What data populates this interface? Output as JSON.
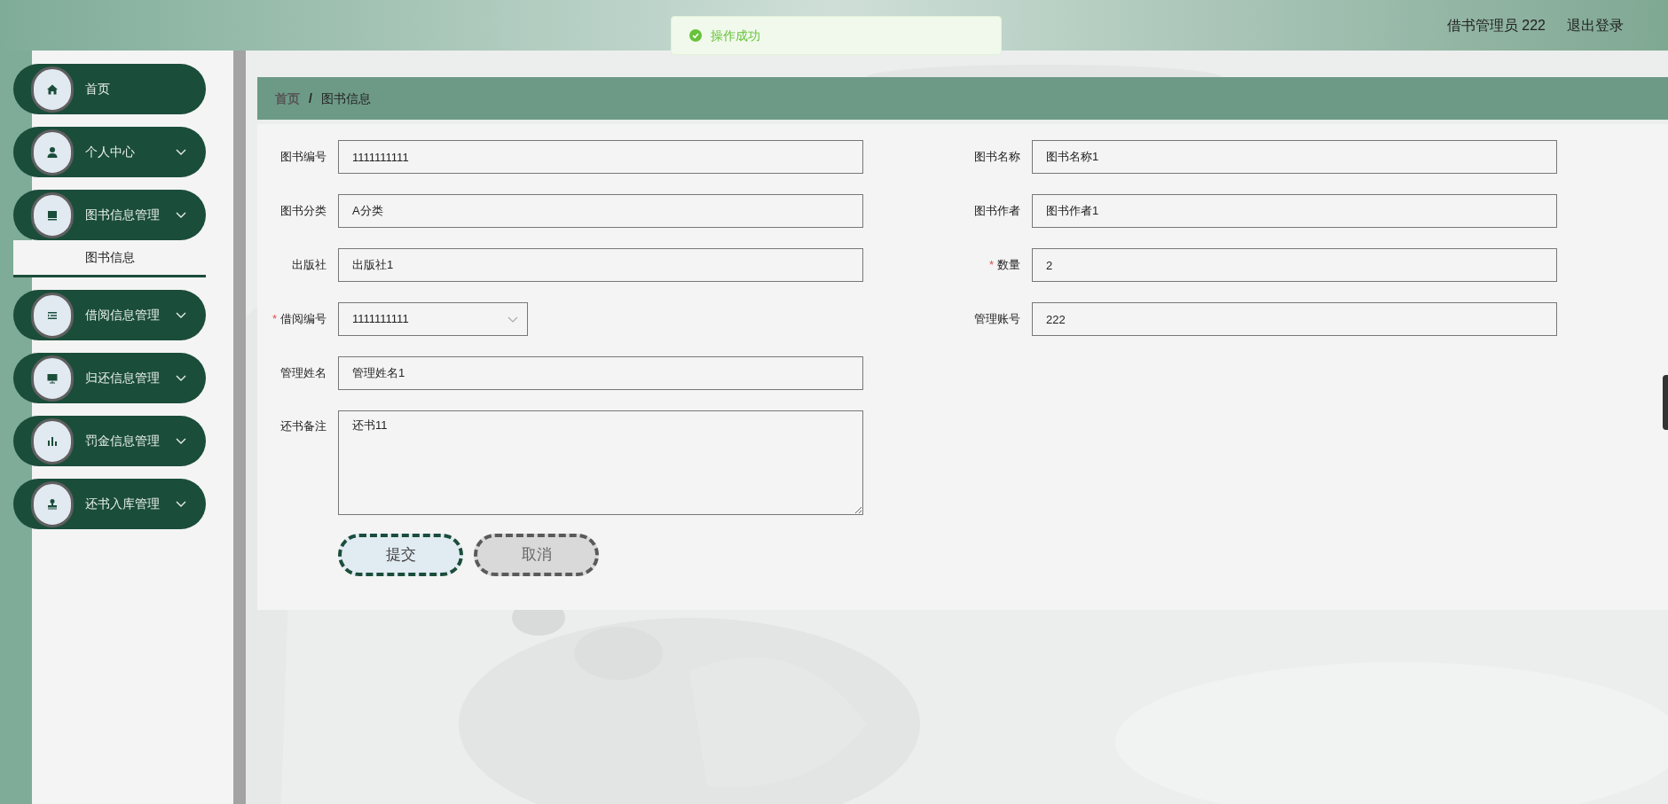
{
  "header": {
    "user": "借书管理员 222",
    "logout": "退出登录"
  },
  "toast": {
    "text": "操作成功"
  },
  "sidebar": {
    "items": [
      {
        "label": "首页",
        "kind": "link"
      },
      {
        "label": "个人中心",
        "kind": "group"
      },
      {
        "label": "图书信息管理",
        "kind": "group",
        "children": [
          {
            "label": "图书信息",
            "selected": true
          }
        ]
      },
      {
        "label": "借阅信息管理",
        "kind": "group"
      },
      {
        "label": "归还信息管理",
        "kind": "group"
      },
      {
        "label": "罚金信息管理",
        "kind": "group"
      },
      {
        "label": "还书入库管理",
        "kind": "group"
      }
    ]
  },
  "breadcrumb": {
    "items": [
      "首页",
      "图书信息"
    ],
    "separator": "/"
  },
  "form": {
    "left": [
      {
        "label": "图书编号",
        "kind": "input",
        "value": "1111111111"
      },
      {
        "label": "图书分类",
        "kind": "input",
        "value": "A分类"
      },
      {
        "label": "出版社",
        "kind": "input",
        "value": "出版社1"
      },
      {
        "label": "借阅编号",
        "kind": "select",
        "required_mark": "*",
        "value": "1111111111"
      },
      {
        "label": "管理姓名",
        "kind": "input",
        "value": "管理姓名1"
      },
      {
        "label": "还书备注",
        "kind": "textarea",
        "value": "还书11"
      }
    ],
    "right": [
      {
        "label": "图书名称",
        "kind": "input",
        "value": "图书名称1"
      },
      {
        "label": "图书作者",
        "kind": "input",
        "value": "图书作者1"
      },
      {
        "label": "数量",
        "kind": "input",
        "required_mark": "*",
        "value": "2"
      },
      {
        "label": "管理账号",
        "kind": "input",
        "value": "222"
      }
    ],
    "buttons": [
      {
        "label": "提交",
        "kind": "primary"
      },
      {
        "label": "取消",
        "kind": "default"
      }
    ]
  }
}
